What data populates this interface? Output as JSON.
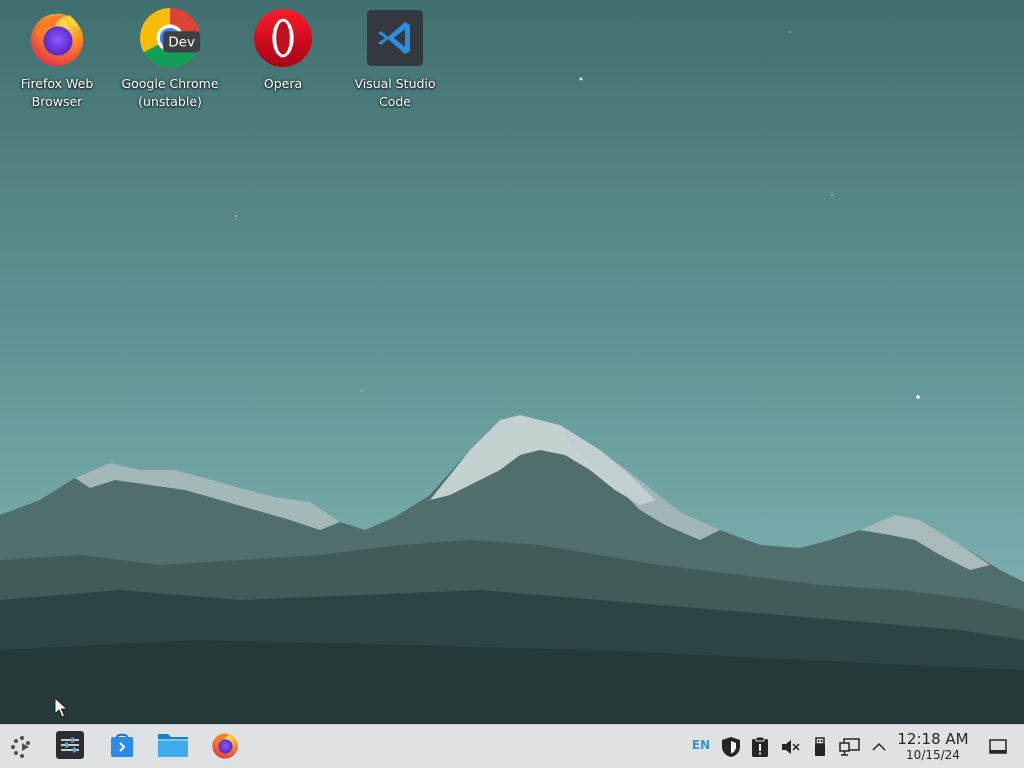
{
  "desktop": {
    "icons": [
      {
        "name": "firefox",
        "label": "Firefox Web\nBrowser",
        "icon": "firefox-icon"
      },
      {
        "name": "chrome-dev",
        "label": "Google Chrome\n(unstable)",
        "icon": "chrome-dev-icon",
        "badge": "Dev"
      },
      {
        "name": "opera",
        "label": "Opera",
        "icon": "opera-icon"
      },
      {
        "name": "vscode",
        "label": "Visual Studio\nCode",
        "icon": "vscode-icon"
      }
    ]
  },
  "taskbar": {
    "launcher_icon": "application-launcher-icon",
    "pinned": [
      {
        "name": "system-settings",
        "icon": "settings-sliders-icon"
      },
      {
        "name": "discover",
        "icon": "software-center-icon"
      },
      {
        "name": "file-manager",
        "icon": "folder-icon"
      },
      {
        "name": "firefox",
        "icon": "firefox-icon"
      }
    ],
    "tray": {
      "language": "EN",
      "icons": [
        "security-shield-icon",
        "clipboard-icon",
        "volume-muted-icon",
        "usb-device-icon",
        "network-icon",
        "expand-tray-icon"
      ]
    },
    "clock": {
      "time": "12:18 AM",
      "date": "10/15/24"
    },
    "show_desktop_icon": "show-desktop-icon"
  },
  "colors": {
    "taskbar_bg": "#dfe2e5",
    "accent": "#3d8fd1",
    "sky_top": "#3f6f6e",
    "sky_bottom": "#7aaeae"
  }
}
